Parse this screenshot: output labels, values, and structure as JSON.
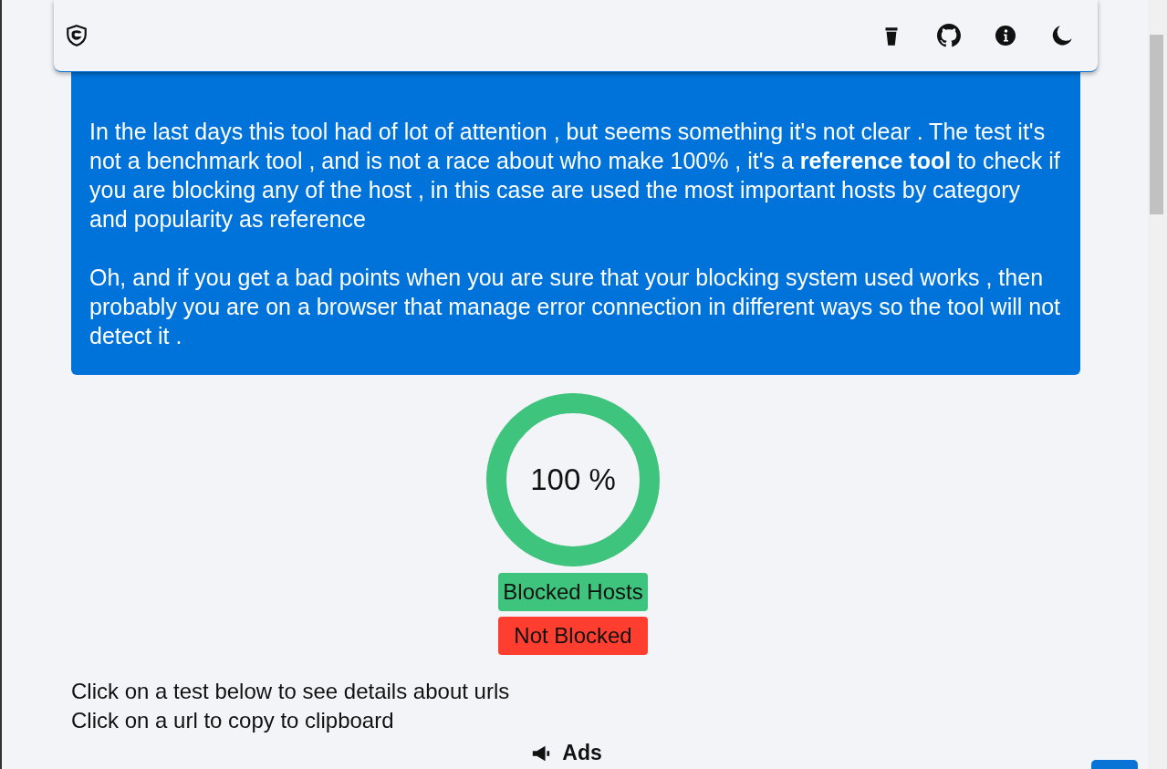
{
  "header": {
    "icons": [
      {
        "kind": "shield"
      },
      {
        "kind": "coffee"
      },
      {
        "kind": "github"
      },
      {
        "kind": "info"
      },
      {
        "kind": "moon"
      }
    ]
  },
  "notice": {
    "paragraphs": [
      "In the last days this tool had of lot of attention , but seems something it's not clear . The test it's not a benchmark tool , and is not a race about who make 100% , it's a **reference tool** to check if you are blocking any of the host , in this case are used the most important hosts by category and popularity as reference",
      "Oh, and if you get a bad points when you are sure that your blocking system used works , then probably you are on a browser that manage error connection in different ways so the tool will not detect it ."
    ]
  },
  "score": {
    "level": 1,
    "reading": "100 %"
  },
  "legend": [
    {
      "label": "Blocked Hosts",
      "color": "#3ec47c"
    },
    {
      "label": "Not Blocked",
      "color": "#ff3e30"
    }
  ],
  "instructions": [
    "Click on a test below to see details about urls",
    "Click on a url to copy to clipboard"
  ],
  "ads": {
    "label": "Ads"
  }
}
